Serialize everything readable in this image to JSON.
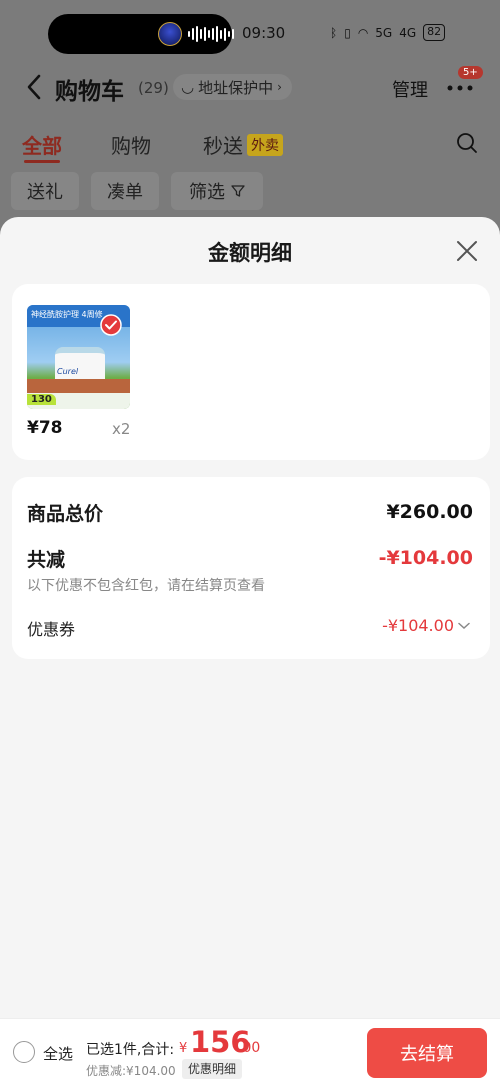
{
  "status_bar": {
    "time": "09:30",
    "battery": "82",
    "signal_1": "5G",
    "signal_2": "4G"
  },
  "nav": {
    "title": "购物车",
    "count": "(29)",
    "address_protect": "地址保护中",
    "manage": "管理",
    "badge": "5+"
  },
  "tabs": [
    {
      "label": "全部",
      "active": true
    },
    {
      "label": "购物",
      "active": false
    },
    {
      "label": "秒送",
      "active": false,
      "tag": "外卖"
    }
  ],
  "filters": [
    "送礼",
    "凑单",
    "筛选"
  ],
  "sheet": {
    "title": "金额明细",
    "product": {
      "image_strip_text": "神经酰胺护理 4周修",
      "image_brand": "Curel",
      "image_price_tag": "130",
      "price": "¥78",
      "quantity": "x2"
    },
    "summary": {
      "total_label": "商品总价",
      "total_value": "¥260.00",
      "reduction_label": "共减",
      "reduction_value": "-¥104.00",
      "note": "以下优惠不包含红包，请在结算页查看",
      "coupon_label": "优惠券",
      "coupon_value": "-¥104.00"
    }
  },
  "bottom_bar": {
    "select_all": "全选",
    "selected_text": "已选1件,合计:",
    "currency": "¥",
    "total_int": "156",
    "total_dec": ".00",
    "discount_text": "优惠减:¥104.00",
    "detail_button": "优惠明细",
    "checkout_button": "去结算"
  },
  "colors": {
    "accent_red": "#e4393c",
    "checkout_bg": "#ee4c45",
    "overlay": "#7a7a7a"
  }
}
